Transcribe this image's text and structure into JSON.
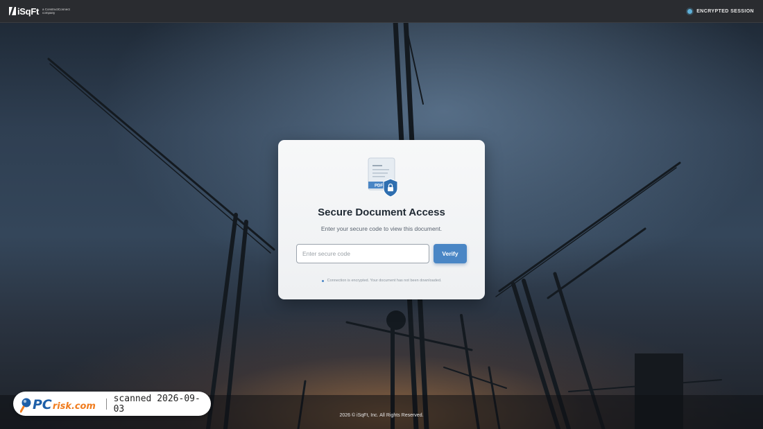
{
  "header": {
    "logo_text": "iSqFt",
    "logo_subtext": "a ConstructConnect company",
    "session_label": "ENCRYPTED SESSION",
    "icons": {
      "logo": "isqft-logo-icon",
      "status": "status-dot-icon"
    }
  },
  "card": {
    "icon": "pdf-lock-document-icon",
    "icon_badge": "PDF",
    "title": "Secure Document Access",
    "subtitle": "Enter your secure code to view this document.",
    "code_input": {
      "value": "",
      "placeholder": "Enter secure code"
    },
    "verify_label": "Verify",
    "note": "Connection is encrypted. Your document has not been downloaded."
  },
  "footer": {
    "copyright": "2026 © iSqFt, Inc. All Rights Reserved."
  },
  "watermark": {
    "brand": "PCrisk.com",
    "brand_pc": "PC",
    "brand_risk": "risk.com",
    "scan_text": "scanned 2026-09-03",
    "icon": "magnifier-icon"
  },
  "colors": {
    "accent": "#4a86c5",
    "topbar": "#2a2c30",
    "session_dot": "#5fb0d8",
    "watermark_orange": "#f07c1e",
    "watermark_blue": "#1d5fa8"
  }
}
